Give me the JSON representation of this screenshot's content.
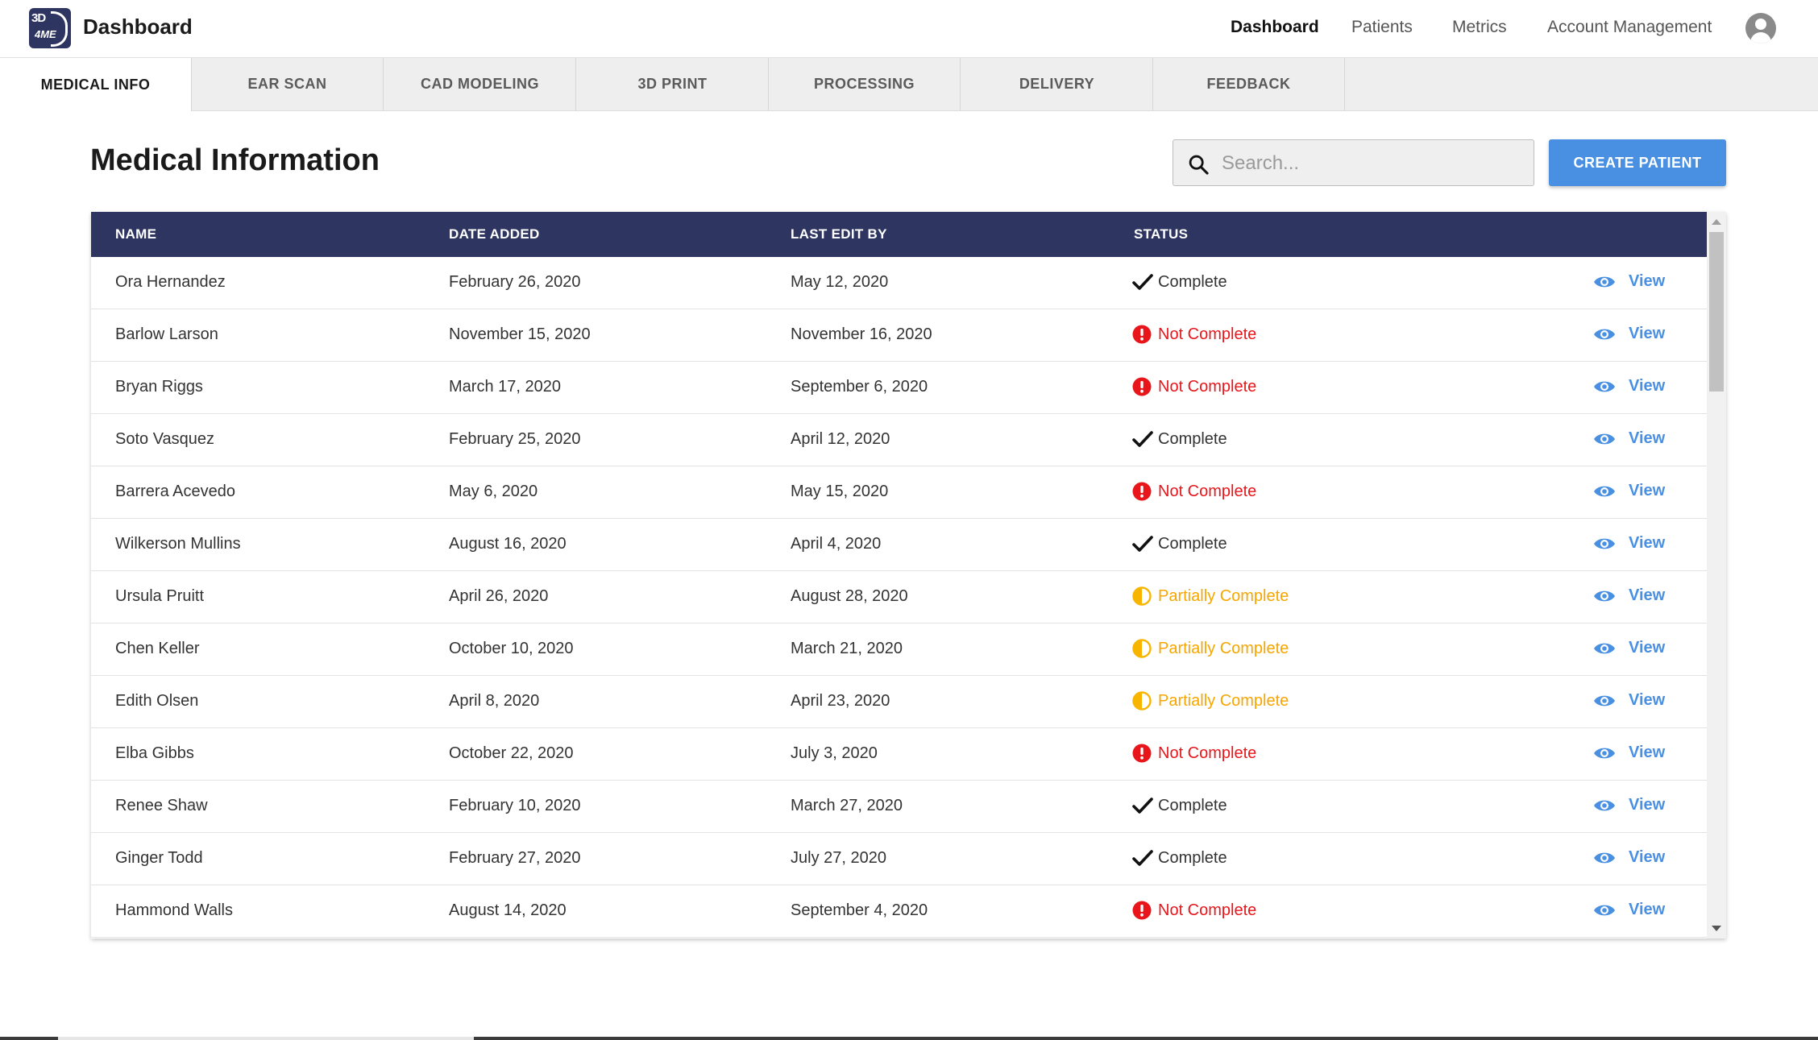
{
  "app": {
    "logo_text_top": "3D",
    "logo_text_bottom": "4ME",
    "title": "Dashboard"
  },
  "topnav": {
    "items": [
      {
        "label": "Dashboard",
        "active": true
      },
      {
        "label": "Patients",
        "active": false
      },
      {
        "label": "Metrics",
        "active": false
      },
      {
        "label": "Account Management",
        "active": false
      }
    ],
    "avatar_icon": "account-circle-icon"
  },
  "tabs": [
    {
      "label": "MEDICAL INFO",
      "active": true
    },
    {
      "label": "EAR SCAN",
      "active": false
    },
    {
      "label": "CAD MODELING",
      "active": false
    },
    {
      "label": "3D PRINT",
      "active": false
    },
    {
      "label": "PROCESSING",
      "active": false
    },
    {
      "label": "DELIVERY",
      "active": false
    },
    {
      "label": "FEEDBACK",
      "active": false
    }
  ],
  "page": {
    "title": "Medical Information",
    "search_placeholder": "Search...",
    "create_button": "CREATE PATIENT"
  },
  "colors": {
    "header_navy": "#2e3561",
    "accent_blue": "#4a90e2",
    "complete": "#333333",
    "not_complete": "#e8161b",
    "partially_complete": "#f7a600"
  },
  "table": {
    "columns": [
      "NAME",
      "DATE ADDED",
      "LAST EDIT BY",
      "STATUS"
    ],
    "view_label": "View",
    "rows": [
      {
        "name": "Ora Hernandez",
        "date_added": "February 26, 2020",
        "last_edit": "May 12, 2020",
        "status": "Complete",
        "status_type": "complete"
      },
      {
        "name": "Barlow Larson",
        "date_added": "November 15, 2020",
        "last_edit": "November 16, 2020",
        "status": "Not Complete",
        "status_type": "not"
      },
      {
        "name": "Bryan Riggs",
        "date_added": "March 17, 2020",
        "last_edit": "September 6, 2020",
        "status": "Not Complete",
        "status_type": "not"
      },
      {
        "name": "Soto Vasquez",
        "date_added": "February 25, 2020",
        "last_edit": "April 12, 2020",
        "status": "Complete",
        "status_type": "complete"
      },
      {
        "name": "Barrera Acevedo",
        "date_added": "May 6, 2020",
        "last_edit": "May 15, 2020",
        "status": "Not Complete",
        "status_type": "not"
      },
      {
        "name": "Wilkerson Mullins",
        "date_added": "August 16, 2020",
        "last_edit": "April 4, 2020",
        "status": "Complete",
        "status_type": "complete"
      },
      {
        "name": "Ursula Pruitt",
        "date_added": "April 26, 2020",
        "last_edit": "August 28, 2020",
        "status": "Partially Complete",
        "status_type": "partial"
      },
      {
        "name": "Chen Keller",
        "date_added": "October 10, 2020",
        "last_edit": "March 21, 2020",
        "status": "Partially Complete",
        "status_type": "partial"
      },
      {
        "name": "Edith Olsen",
        "date_added": "April 8, 2020",
        "last_edit": "April 23, 2020",
        "status": "Partially Complete",
        "status_type": "partial"
      },
      {
        "name": "Elba Gibbs",
        "date_added": "October 22, 2020",
        "last_edit": "July 3, 2020",
        "status": "Not Complete",
        "status_type": "not"
      },
      {
        "name": "Renee Shaw",
        "date_added": "February 10, 2020",
        "last_edit": "March 27, 2020",
        "status": "Complete",
        "status_type": "complete"
      },
      {
        "name": "Ginger Todd",
        "date_added": "February 27, 2020",
        "last_edit": "July 27, 2020",
        "status": "Complete",
        "status_type": "complete"
      },
      {
        "name": "Hammond Walls",
        "date_added": "August 14, 2020",
        "last_edit": "September 4, 2020",
        "status": "Not Complete",
        "status_type": "not"
      }
    ]
  }
}
